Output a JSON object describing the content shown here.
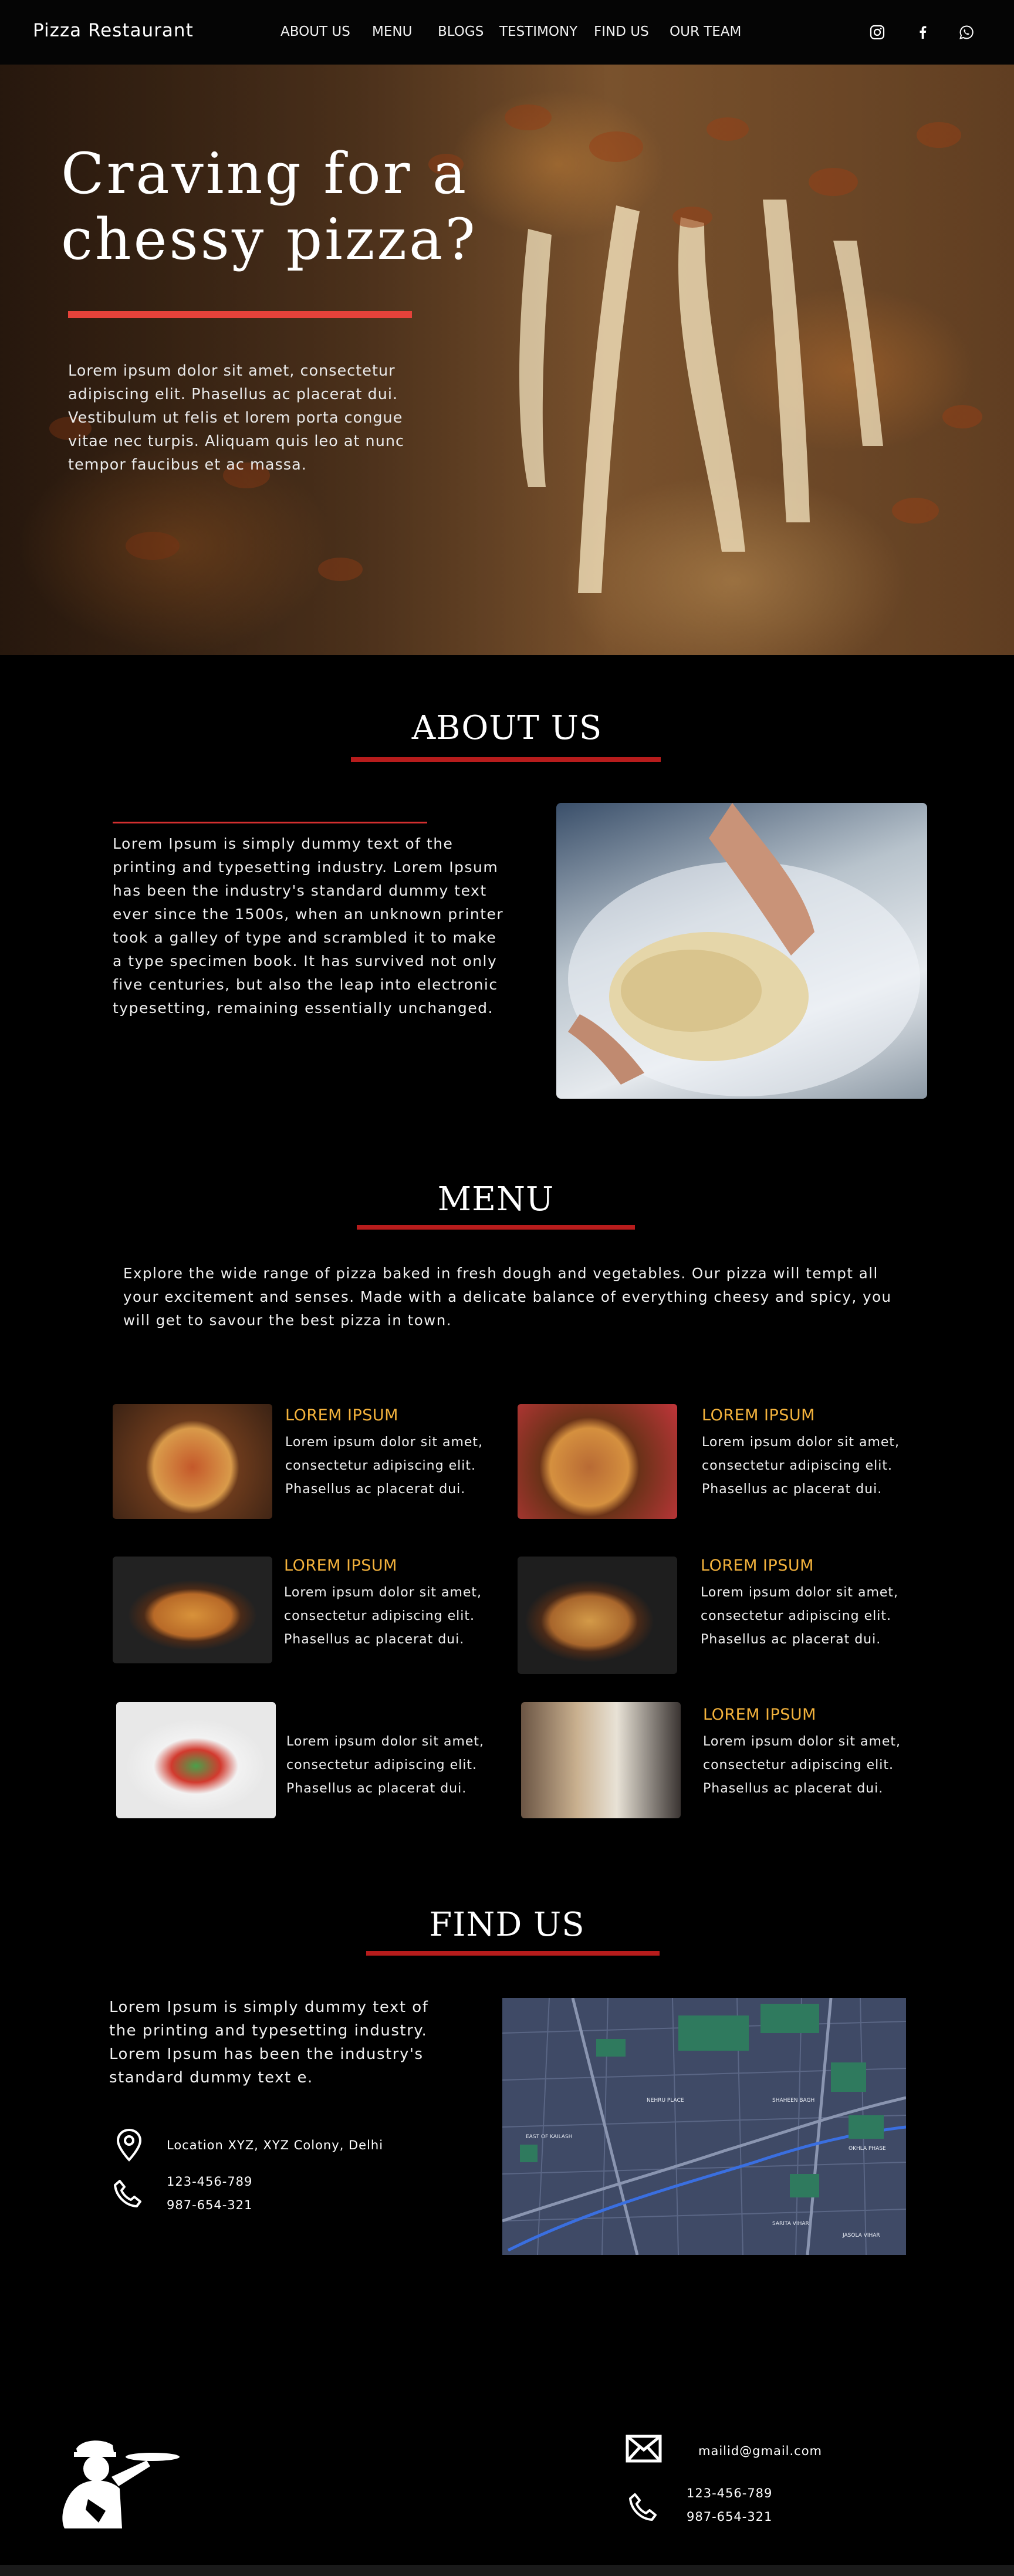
{
  "nav": {
    "brand": "Pizza Restaurant",
    "links": [
      "ABOUT US",
      "MENU",
      "BLOGS",
      "TESTIMONY",
      "FIND US",
      "OUR TEAM"
    ],
    "social": [
      "instagram-icon",
      "facebook-icon",
      "whatsapp-icon"
    ]
  },
  "hero": {
    "title_line1": "Craving for a",
    "title_line2": "chessy pizza?",
    "text": "Lorem ipsum dolor sit amet, consectetur adipiscing elit. Phasellus ac placerat dui. Vestibulum ut felis et lorem porta congue vitae nec turpis. Aliquam quis leo at nunc tempor faucibus et ac massa."
  },
  "about": {
    "title": "ABOUT US",
    "text": "Lorem Ipsum is simply dummy text of the printing and typesetting industry. Lorem Ipsum has been the industry's standard dummy text ever since the 1500s, when an unknown printer took a galley of type and scrambled it to make a type specimen book. It has survived not only five centuries, but also the leap into electronic typesetting, remaining essentially unchanged."
  },
  "menu": {
    "title": "MENU",
    "intro": "Explore the wide range of pizza baked in fresh dough and vegetables. Our pizza will tempt all your excitement and senses. Made with a delicate balance of everything cheesy and spicy, you will get to savour the best pizza in town.",
    "items": [
      {
        "title": "LOREM IPSUM",
        "desc": "Lorem ipsum dolor sit amet, consectetur adipiscing elit. Phasellus ac placerat dui."
      },
      {
        "title": "LOREM IPSUM",
        "desc": "Lorem ipsum dolor sit amet, consectetur adipiscing elit. Phasellus ac placerat dui."
      },
      {
        "title": "LOREM IPSUM",
        "desc": "Lorem ipsum dolor sit amet, consectetur adipiscing elit. Phasellus ac placerat dui."
      },
      {
        "title": "LOREM IPSUM",
        "desc": "Lorem ipsum dolor sit amet, consectetur adipiscing elit. Phasellus ac placerat dui."
      },
      {
        "title": "",
        "desc": "Lorem ipsum dolor sit amet, consectetur adipiscing elit. Phasellus ac placerat dui."
      },
      {
        "title": "LOREM IPSUM",
        "desc": "Lorem ipsum dolor sit amet, consectetur adipiscing elit. Phasellus ac placerat dui."
      }
    ]
  },
  "find": {
    "title": "FIND US",
    "text": "Lorem Ipsum is simply dummy text of the printing and typesetting industry. Lorem Ipsum has been the industry's standard dummy text e.",
    "location": "Location XYZ, XYZ Colony, Delhi",
    "phone1": "123-456-789",
    "phone2": "987-654-321",
    "map_labels": [
      "NEHRU PLACE",
      "SHAHEEN BAGH",
      "EAST OF KAILASH",
      "OKHLA PHASE",
      "SARITA VIHAR",
      "JASOLA VIHAR"
    ]
  },
  "footer": {
    "email": "mailid@gmail.com",
    "phone1": "123-456-789",
    "phone2": "987-654-321"
  },
  "colors": {
    "accent_red": "#b71c1c",
    "hero_line": "#e5423a",
    "menu_title": "#f3b23c",
    "map_bg": "#3f4a66",
    "map_green": "#2f7a5e"
  }
}
